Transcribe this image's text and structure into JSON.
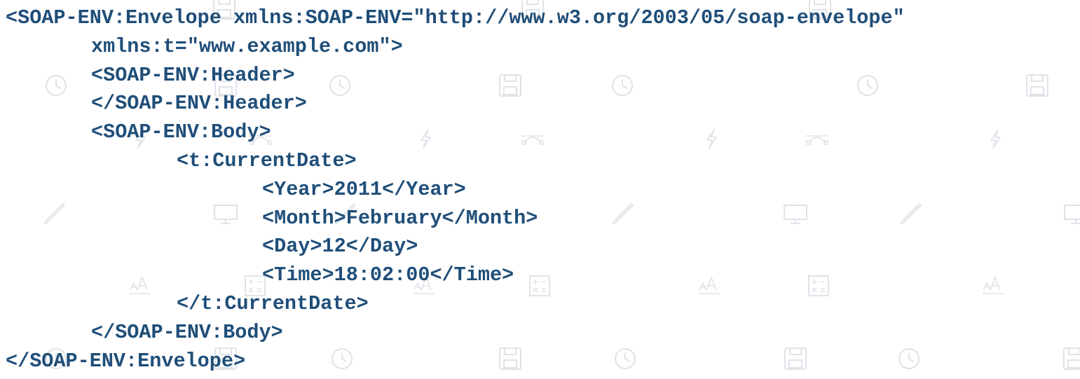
{
  "document": {
    "lines": [
      {
        "indent": 0,
        "text": "<SOAP-ENV:Envelope xmlns:SOAP-ENV=\"http://www.w3.org/2003/05/soap-envelope\""
      },
      {
        "indent": 1,
        "text": "xmlns:t=\"www.example.com\">"
      },
      {
        "indent": 1,
        "text": "<SOAP-ENV:Header>"
      },
      {
        "indent": 1,
        "text": "</SOAP-ENV:Header>"
      },
      {
        "indent": 1,
        "text": "<SOAP-ENV:Body>"
      },
      {
        "indent": 2,
        "text": "<t:CurrentDate>"
      },
      {
        "indent": 3,
        "text": "<Year>2011</Year>"
      },
      {
        "indent": 3,
        "text": "<Month>February</Month>"
      },
      {
        "indent": 3,
        "text": "<Day>12</Day>"
      },
      {
        "indent": 3,
        "text": "<Time>18:02:00</Time>"
      },
      {
        "indent": 2,
        "text": "</t:CurrentDate>"
      },
      {
        "indent": 1,
        "text": "</SOAP-ENV:Body>"
      },
      {
        "indent": 0,
        "text": "</SOAP-ENV:Envelope>"
      }
    ]
  },
  "background": {
    "icons": [
      "clock-icon",
      "save-icon",
      "lightning-icon",
      "bezier-curve-icon",
      "pencil-icon",
      "monitor-icon",
      "font-size-icon",
      "calculator-icon"
    ]
  },
  "colors": {
    "text": "#1f4e79",
    "pattern": "#dfe3e8",
    "background": "#ffffff"
  }
}
